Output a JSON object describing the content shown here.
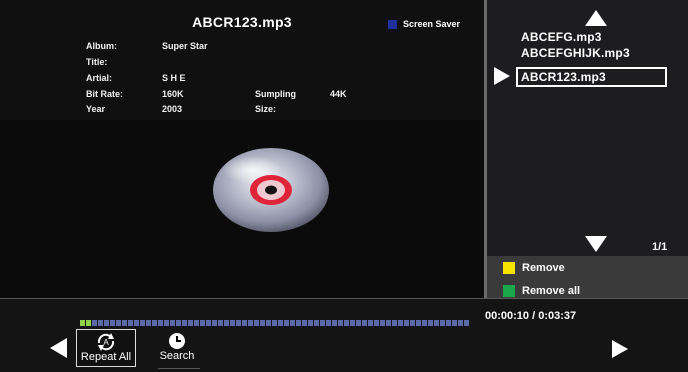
{
  "now_playing": {
    "filename": "ABCR123.mp3",
    "fields": {
      "album_label": "Album:",
      "album_value": "Super Star",
      "title_label": "Title:",
      "title_value": "",
      "artist_label": "Artial:",
      "artist_value": "S H E",
      "bitrate_label": "Bit Rate:",
      "bitrate_value": "160K",
      "sampling_label": "Sumpling",
      "sampling_value": "44K",
      "year_label": "Year",
      "year_value": "2003",
      "size_label": "Size:",
      "size_value": ""
    }
  },
  "screen_saver": {
    "label": "Screen Saver",
    "color": "#1f2f9a"
  },
  "playlist": {
    "items": [
      "ABCEFG.mp3",
      "ABCEFGHIJK.mp3",
      "ABCR123.mp3"
    ],
    "selected_index": 2,
    "page": "1/1"
  },
  "actions": {
    "remove_label": "Remove",
    "remove_color": "#f4e400",
    "remove_all_label": "Remove all",
    "remove_all_color": "#1aa64a"
  },
  "progress": {
    "fraction": 0.03,
    "elapsed_total": "00:00:10 / 0:03:37"
  },
  "controls": {
    "repeat_label": "Repeat All",
    "repeat_icon_letter": "A",
    "search_label": "Search"
  }
}
